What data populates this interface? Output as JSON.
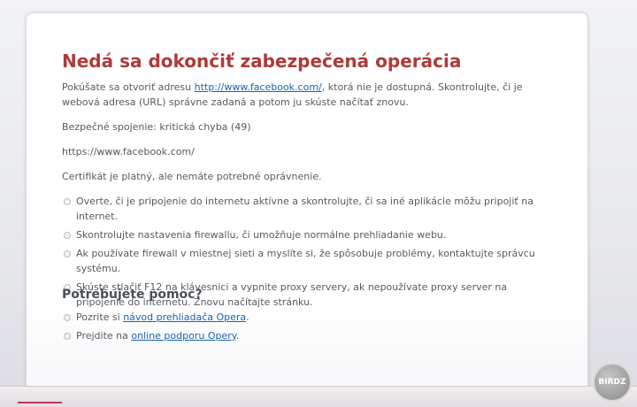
{
  "error": {
    "title": "Nedá sa dokončiť zabezpečená operácia",
    "intro_before": "Pokúšate sa otvoriť adresu ",
    "intro_link": "http://www.facebook.com/",
    "intro_after": ", ktorá nie je dostupná. Skontrolujte, či je webová adresa (URL) správne zadaná a potom ju skúste načítať znovu.",
    "security_line": "Bezpečné spojenie: kritická chyba (49)",
    "url_line": "https://www.facebook.com/",
    "cert_line": "Certifikát je platný, ale nemáte potrebné oprávnenie.",
    "suggestions": [
      "Overte, či je pripojenie do internetu aktívne a skontrolujte, či sa iné aplikácie môžu pripojiť na internet.",
      "Skontrolujte nastavenia firewallu, či umožňuje normálne prehliadanie webu.",
      "Ak používate firewall v miestnej sieti a myslíte si, že spôsobuje problémy, kontaktujte správcu systému.",
      "Skúste stlačiť F12 na klávesnici a vypnite proxy servery, ak nepoužívate proxy server na pripojenie do internetu. Znovu načítajte stránku."
    ]
  },
  "help": {
    "heading": "Potrebujete pomoc?",
    "item1_before": "Pozrite si ",
    "item1_link": "návod prehliadača Opera",
    "item1_after": ".",
    "item2_before": "Prejdite na ",
    "item2_link": "online podporu Opery",
    "item2_after": "."
  },
  "watermark": "BIRDZ",
  "colors": {
    "title": "#b0393a",
    "link": "#1a63b0",
    "text": "#555b62"
  }
}
